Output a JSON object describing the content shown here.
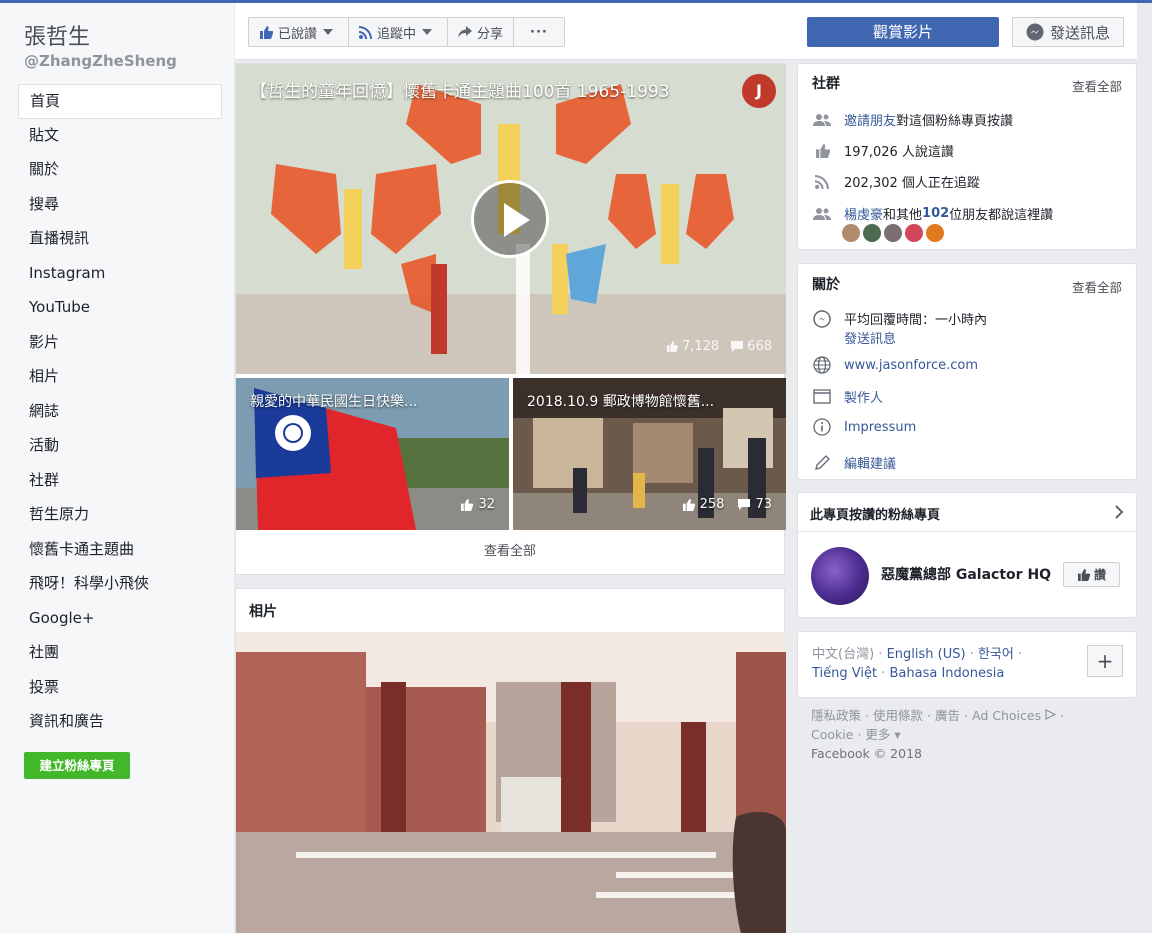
{
  "page": {
    "name": "張哲生",
    "handle": "@ZhangZheSheng"
  },
  "nav": [
    {
      "label": "首頁"
    },
    {
      "label": "貼文"
    },
    {
      "label": "關於"
    },
    {
      "label": "搜尋"
    },
    {
      "label": "直播視訊"
    },
    {
      "label": "Instagram"
    },
    {
      "label": "YouTube"
    },
    {
      "label": "影片"
    },
    {
      "label": "相片"
    },
    {
      "label": "網誌"
    },
    {
      "label": "活動"
    },
    {
      "label": "社群"
    },
    {
      "label": "哲生原力"
    },
    {
      "label": "懷舊卡通主題曲"
    },
    {
      "label": "飛呀！科學小飛俠"
    },
    {
      "label": "Google+"
    },
    {
      "label": "社團"
    },
    {
      "label": "投票"
    },
    {
      "label": "資訊和廣告"
    }
  ],
  "create_page_label": "建立粉絲專頁",
  "actionbar": {
    "liked": "已說讚",
    "following": "追蹤中",
    "share": "分享",
    "more": "···",
    "watch_video": "觀賞影片",
    "send_message": "發送訊息"
  },
  "videos": {
    "main_title": "【哲生的童年回憶】懷舊卡通主題曲100首 1965-1993",
    "main_likes": "7,128",
    "main_comments": "668",
    "channel_logo": "J",
    "thumb1_title": "親愛的中華民國生日快樂...",
    "thumb1_likes": "32",
    "thumb2_title": "2018.10.9 郵政博物館懷舊...",
    "thumb2_likes": "258",
    "thumb2_comments": "73",
    "see_all": "查看全部"
  },
  "photos": {
    "title": "相片"
  },
  "community": {
    "title": "社群",
    "see_all": "查看全部",
    "invite_link": "邀請朋友",
    "invite_text": " 對這個粉絲專頁按讚",
    "likes": "197,026 人說這讚",
    "follows": "202,302 個人正在追蹤",
    "friends_name": "楊虔豪",
    "friends_mid": "和其他 ",
    "friends_count": "102",
    "friends_end": " 位朋友都說這裡讚"
  },
  "about": {
    "title": "關於",
    "see_all": "查看全部",
    "response_time": "平均回覆時間：一小時內",
    "send_message": "發送訊息",
    "website": "www.jasonforce.com",
    "producer": "製作人",
    "impressum": "Impressum",
    "suggest_edits": "編輯建議"
  },
  "liked_pages": {
    "title": "此專頁按讚的粉絲專頁",
    "page_name": "惡魔黨總部 Galactor HQ",
    "like_label": "讚"
  },
  "languages": {
    "current": "中文(台灣)",
    "others": [
      "English (US)",
      "한국어",
      "Tiếng Việt",
      "Bahasa Indonesia"
    ],
    "add": "+"
  },
  "footer": {
    "links": [
      "隱私政策",
      "使用條款",
      "廣告",
      "Ad Choices",
      "Cookie",
      "更多"
    ],
    "copyright": "Facebook © 2018"
  },
  "colors": {
    "brand_blue": "#4267b2",
    "link_blue": "#365899",
    "green": "#42b72a",
    "background": "#e9ebee"
  }
}
